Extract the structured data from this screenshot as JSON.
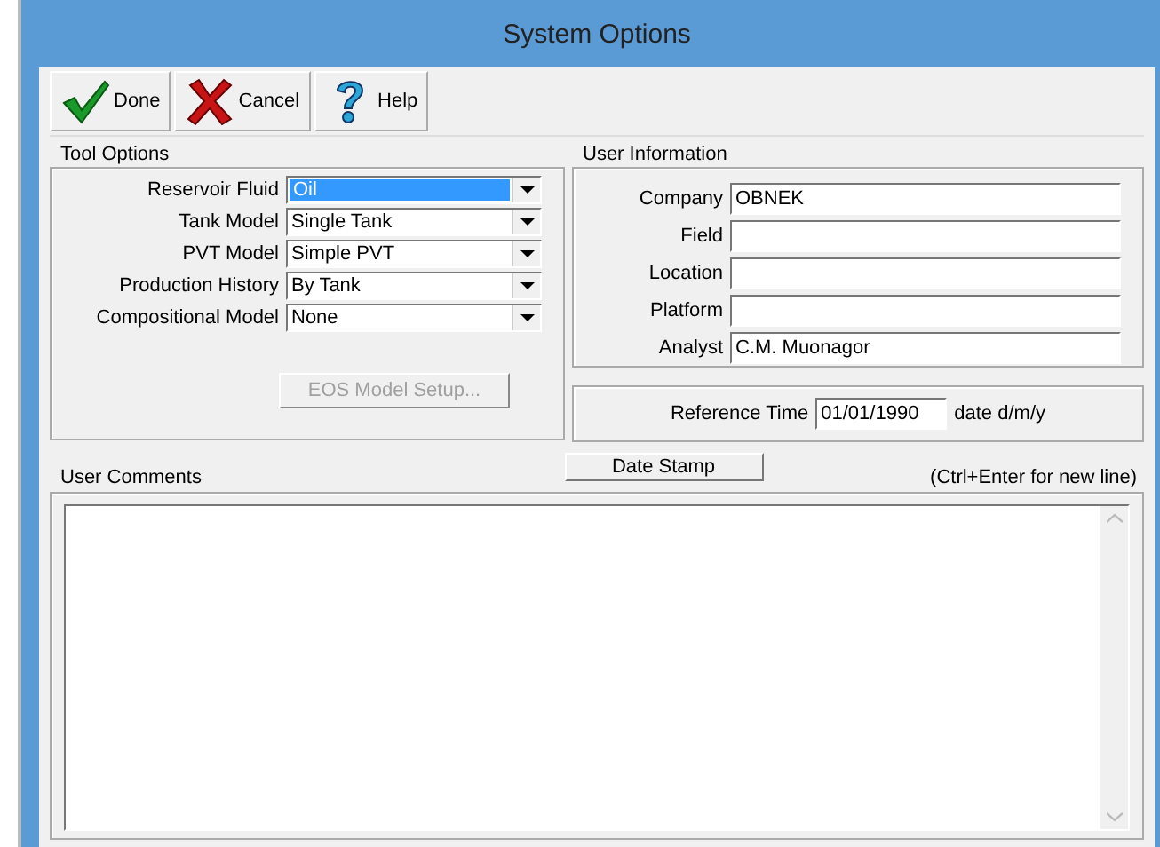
{
  "window": {
    "title": "System Options"
  },
  "toolbar": [
    {
      "kind": "check",
      "label": "Done"
    },
    {
      "kind": "cross",
      "label": "Cancel"
    },
    {
      "kind": "question",
      "label": "Help"
    }
  ],
  "tool_options": {
    "title": "Tool Options",
    "dropdowns": [
      {
        "label": "Reservoir Fluid",
        "value": "Oil",
        "selected": true
      },
      {
        "label": "Tank Model",
        "value": "Single Tank",
        "selected": false
      },
      {
        "label": "PVT Model",
        "value": "Simple PVT",
        "selected": false
      },
      {
        "label": "Production History",
        "value": "By Tank",
        "selected": false
      },
      {
        "label": "Compositional Model",
        "value": "None",
        "selected": false
      }
    ],
    "eos_button": {
      "label": "EOS Model Setup...",
      "disabled": true
    }
  },
  "user_information": {
    "title": "User Information",
    "fields": [
      {
        "label": "Company",
        "value": "OBNEK"
      },
      {
        "label": "Field"
      },
      {
        "label": "Location"
      },
      {
        "label": "Platform"
      },
      {
        "label": "Analyst",
        "value": "C.M. Muonagor"
      }
    ]
  },
  "reference_time": {
    "label": "Reference Time",
    "value": "01/01/1990",
    "hint": "date d/m/y"
  },
  "comments": {
    "title": "User Comments",
    "date_stamp_button": "Date Stamp",
    "hint": "(Ctrl+Enter for new line)"
  }
}
